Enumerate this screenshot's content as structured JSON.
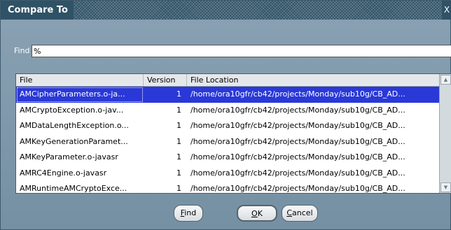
{
  "window": {
    "title": "Compare To",
    "close_glyph": "X"
  },
  "find": {
    "label": "Find",
    "value": "%"
  },
  "table": {
    "columns": [
      "File",
      "Version",
      "File Location"
    ],
    "rows": [
      {
        "file": "AMCipherParameters.o-ja...",
        "version": "1",
        "location": "/home/ora10gfr/cb42/projects/Monday/sub10g/CB_AD...",
        "selected": true
      },
      {
        "file": "AMCryptoException.o-jav...",
        "version": "1",
        "location": "/home/ora10gfr/cb42/projects/Monday/sub10g/CB_AD..."
      },
      {
        "file": "AMDataLengthException.o...",
        "version": "1",
        "location": "/home/ora10gfr/cb42/projects/Monday/sub10g/CB_AD..."
      },
      {
        "file": "AMKeyGenerationParamet...",
        "version": "1",
        "location": "/home/ora10gfr/cb42/projects/Monday/sub10g/CB_AD..."
      },
      {
        "file": "AMKeyParameter.o-javasr",
        "version": "1",
        "location": "/home/ora10gfr/cb42/projects/Monday/sub10g/CB_AD..."
      },
      {
        "file": "AMRC4Engine.o-javasr",
        "version": "1",
        "location": "/home/ora10gfr/cb42/projects/Monday/sub10g/CB_AD..."
      },
      {
        "file": "AMRuntimeAMCryptoExce...",
        "version": "1",
        "location": "/home/ora10gfr/cb42/projects/Monday/sub10g/CB_AD..."
      }
    ]
  },
  "buttons": {
    "find": {
      "first": "F",
      "rest": "ind"
    },
    "ok": {
      "first": "O",
      "rest": "K"
    },
    "cancel": {
      "first": "C",
      "rest": "ancel"
    }
  },
  "colors": {
    "titlebar": "#2f5266",
    "selection": "#2a38d8",
    "dialog_bg": "#7b94a6"
  }
}
